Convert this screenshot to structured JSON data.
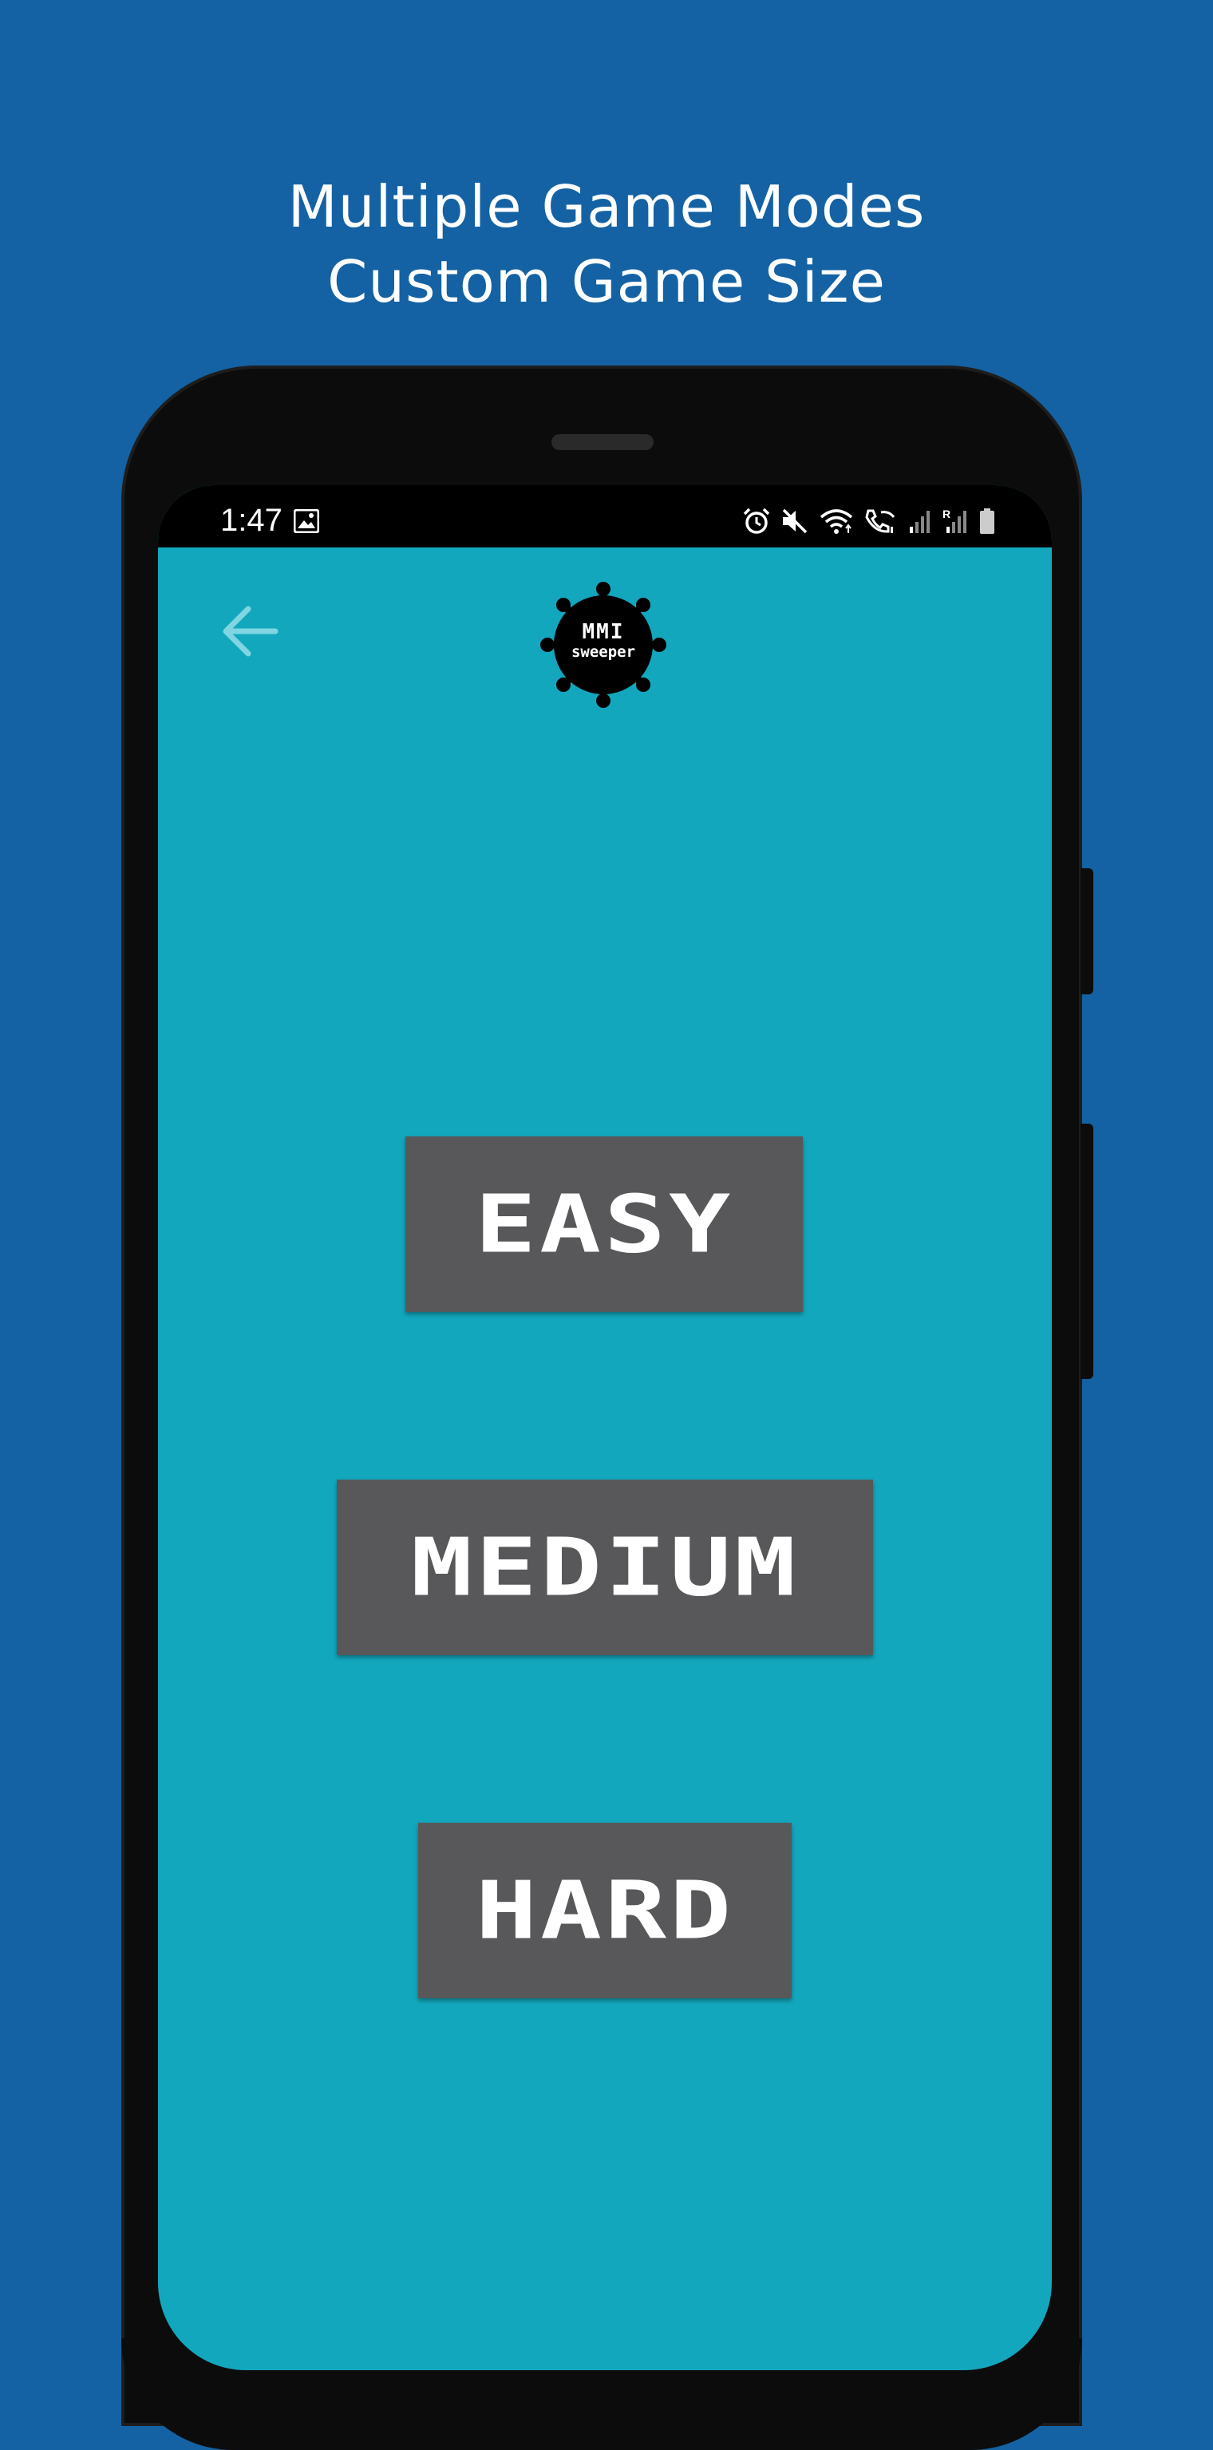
{
  "promo": {
    "line1": "Multiple Game Modes",
    "line2": "Custom Game Size"
  },
  "status_bar": {
    "time": "1:47",
    "icons": [
      "image-icon",
      "alarm-icon",
      "mute-icon",
      "wifi-icon",
      "wifi-call-icon",
      "signal-icon",
      "signal-roaming-icon",
      "battery-icon"
    ],
    "roaming_label": "R"
  },
  "app": {
    "back_icon": "arrow-left-icon",
    "logo": {
      "title": "MMI",
      "subtitle": "sweeper"
    },
    "modes": [
      {
        "label": "EASY"
      },
      {
        "label": "MEDIUM"
      },
      {
        "label": "HARD"
      }
    ]
  },
  "colors": {
    "page_background": "#1462a3",
    "screen_background": "#13a7bd",
    "button_background": "#58585a",
    "back_arrow": "#7fd6e2"
  }
}
